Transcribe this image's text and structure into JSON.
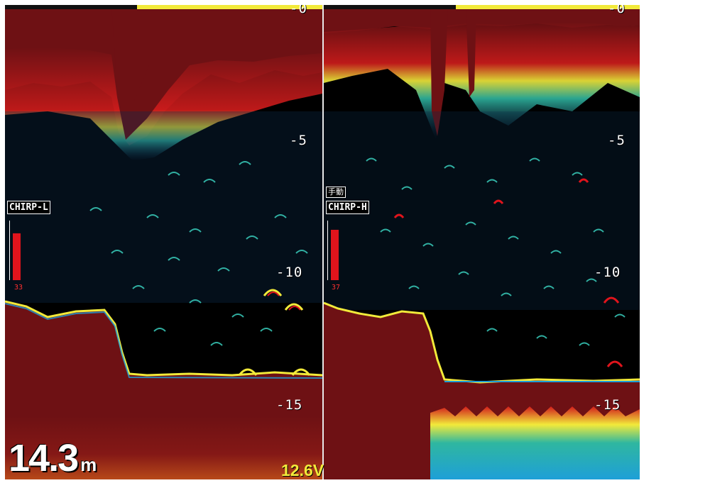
{
  "left_pane": {
    "mode": "CHIRP-L",
    "gain_value": "33",
    "gain_level": 0.78,
    "depth_scale": [
      "-0",
      "-5",
      "-10",
      "-15"
    ]
  },
  "right_pane": {
    "manual_label": "手動",
    "mode": "CHIRP-H",
    "gain_value": "37",
    "gain_level": 0.85,
    "depth_scale": [
      "-0",
      "-5",
      "-10",
      "-15"
    ]
  },
  "readout": {
    "depth_value": "14.3",
    "depth_unit": "m",
    "voltage": "12.6V"
  },
  "colors": {
    "background": "#000000",
    "seabed": "#6e1114",
    "strong_echo": "#e0141c",
    "medium_echo": "#f2ea3a",
    "weak_echo": "#1e9fd8",
    "accent": "#f2ea3a"
  }
}
